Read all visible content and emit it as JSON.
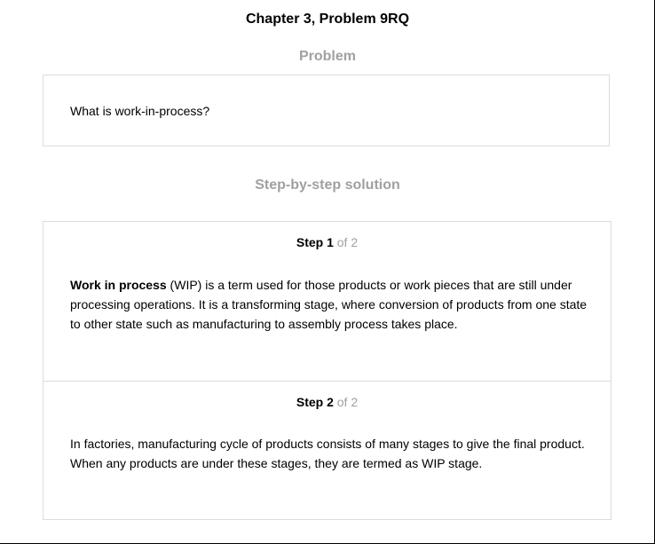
{
  "header": {
    "title": "Chapter 3, Problem 9RQ"
  },
  "problem": {
    "heading": "Problem",
    "text": "What is work-in-process?"
  },
  "solution": {
    "heading": "Step-by-step solution",
    "steps": [
      {
        "label": "Step 1",
        "of_text": " of 2",
        "bold_lead": "Work in process",
        "body": " (WIP) is a term used for those products or work pieces that are still under processing operations. It is a transforming stage, where conversion of products from one state to other state such as manufacturing to assembly process takes place."
      },
      {
        "label": "Step 2",
        "of_text": " of 2",
        "body": "In factories, manufacturing cycle of products consists of many stages to give the final product. When any products are under these stages, they are termed as WIP stage."
      }
    ]
  }
}
